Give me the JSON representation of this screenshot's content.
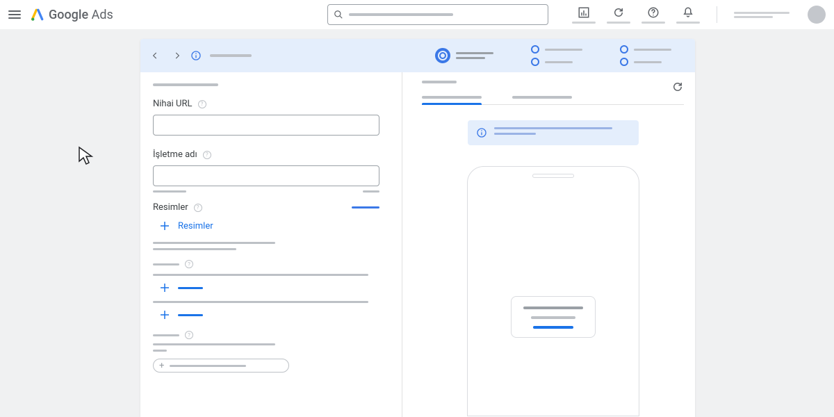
{
  "app": {
    "product": "Google",
    "sub": "Ads"
  },
  "form": {
    "final_url_label": "Nihai URL",
    "business_label": "İşletme adı",
    "images_label": "Resimler",
    "add_images": "Resimler"
  }
}
